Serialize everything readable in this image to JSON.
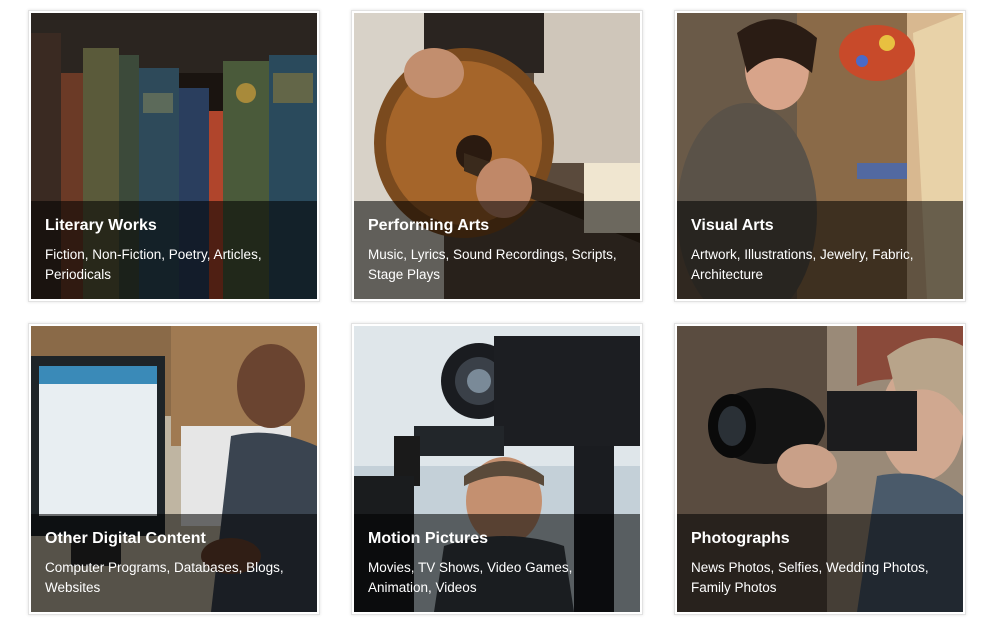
{
  "categories": [
    {
      "title": "Literary Works",
      "description": "Fiction, Non-Fiction, Poetry, Articles, Periodicals",
      "photo": "bookshelf-photo"
    },
    {
      "title": "Performing Arts",
      "description": "Music, Lyrics, Sound Recordings, Scripts, Stage Plays",
      "photo": "guitar-player-photo"
    },
    {
      "title": "Visual Arts",
      "description": "Artwork, Illustrations, Jewelry, Fabric, Architecture",
      "photo": "painter-photo"
    },
    {
      "title": "Other Digital Content",
      "description": "Computer Programs, Databases, Blogs, Websites",
      "photo": "computer-user-photo"
    },
    {
      "title": "Motion Pictures",
      "description": "Movies, TV Shows, Video Games, Animation, Videos",
      "photo": "video-camera-operator-photo"
    },
    {
      "title": "Photographs",
      "description": "News Photos, Selfies, Wedding Photos, Family Photos",
      "photo": "photographer-photo"
    }
  ],
  "colors": {
    "overlay": "#000000",
    "text": "#ffffff",
    "card_border": "#e2e2e2"
  }
}
